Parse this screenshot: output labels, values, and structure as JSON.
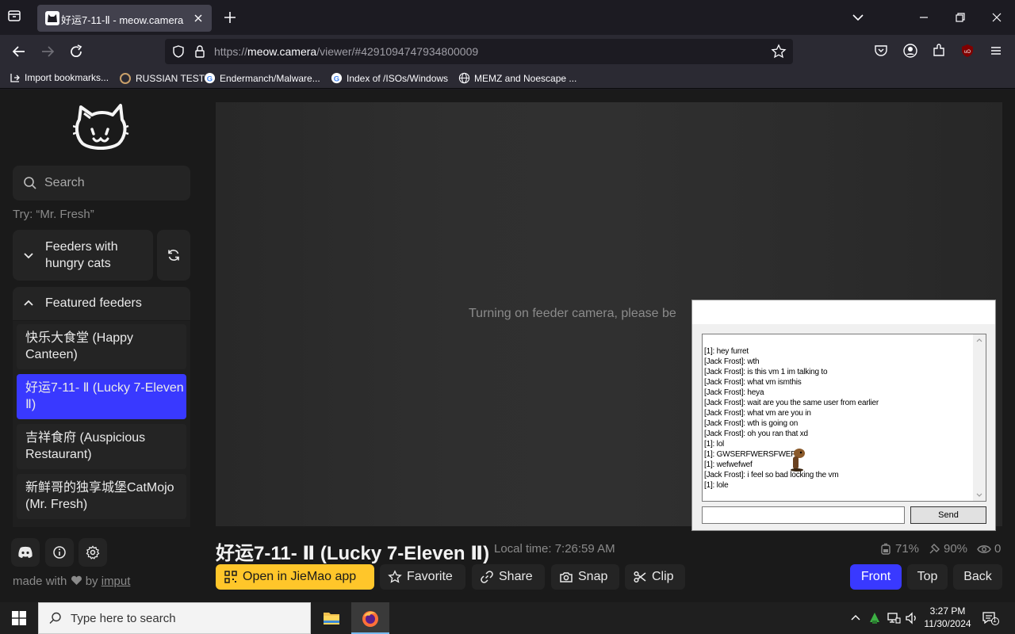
{
  "browser": {
    "tab_title": "好运7-11-Ⅱ - meow.camera",
    "url_scheme": "https://",
    "url_host": "meow.camera",
    "url_path": "/viewer/#4291094747934800009",
    "bookmarks": [
      {
        "label": "Import bookmarks...",
        "icon": "import-icon"
      },
      {
        "label": "RUSSIAN TEST",
        "icon": "page-icon"
      },
      {
        "label": "Endermanch/Malware...",
        "icon": "google-icon"
      },
      {
        "label": "Index of /ISOs/Windows",
        "icon": "google-icon"
      },
      {
        "label": "MEMZ and Noescape ...",
        "icon": "globe-icon"
      }
    ]
  },
  "sidebar": {
    "search_placeholder": "Search",
    "hint": "Try: “Mr. Fresh”",
    "hungry_section": "Feeders with hungry cats",
    "featured_section": "Featured feeders",
    "feeders": [
      {
        "label": "快乐大食堂 (Happy Canteen)"
      },
      {
        "label": "好运7-11- Ⅱ (Lucky 7-Eleven Ⅱ)",
        "active": true
      },
      {
        "label": "吉祥食府 (Auspicious Restaurant)"
      },
      {
        "label": "新鲜哥的独享城堡CatMojo (Mr. Fresh)"
      }
    ],
    "made_with": "made with",
    "by": "by",
    "author": "imput"
  },
  "viewer": {
    "status": "Turning on feeder camera, please be",
    "title": "好运7-11- Ⅱ (Lucky 7-Eleven Ⅱ)",
    "local_time": "Local time: 7:26:59 AM",
    "food_level": "71%",
    "battery_level": "90%",
    "viewers": "0",
    "actions": {
      "open_app": "Open in JieMao app",
      "favorite": "Favorite",
      "share": "Share",
      "snap": "Snap",
      "clip": "Clip"
    },
    "cameras": {
      "front": "Front",
      "top": "Top",
      "back": "Back"
    }
  },
  "chat": {
    "lines": [
      "[1]: hey furret",
      "[Jack Frost]: wth",
      "[Jack Frost]: is this vm 1 im talking to",
      "[Jack Frost]: what vm ismthis",
      "[Jack Frost]: heya",
      "[Jack Frost]: wait are you the same user from earlier",
      "[Jack Frost]: what vm are you in",
      "[Jack Frost]: wth is going on",
      "[Jack Frost]: oh you ran that xd",
      "[1]: lol",
      "[1]: GWSERFWERSFWEF",
      "[1]: wefwefwef",
      "[Jack Frost]: i feel so bad locking the vm",
      "[1]: lole"
    ],
    "send_label": "Send"
  },
  "taskbar": {
    "search_placeholder": "Type here to search",
    "time": "3:27 PM",
    "date": "11/30/2024",
    "notification_count": "1"
  },
  "colors": {
    "accent": "#3939ff",
    "app_button": "#ffc62a",
    "page_bg": "#1a1a1a"
  }
}
